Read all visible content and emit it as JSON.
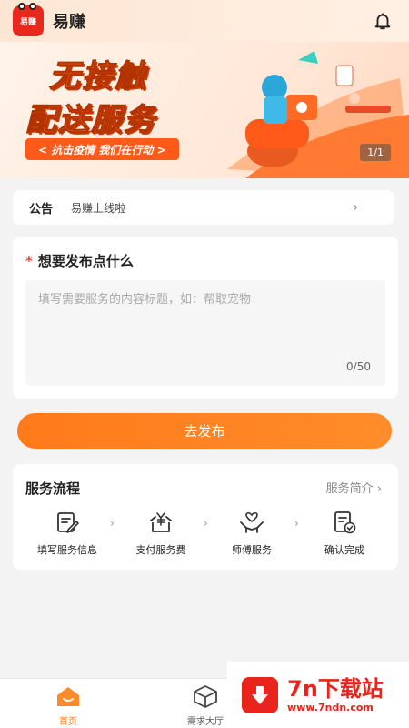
{
  "header": {
    "logo_text": "易赚",
    "app_name": "易赚"
  },
  "banner": {
    "title_line1": "无接触",
    "title_line2": "配送服务",
    "slogan": "< 抗击疫情 我们在行动 >",
    "pager": "1/1"
  },
  "notice": {
    "label": "公告",
    "text": "易赚上线啦",
    "arrow": "›"
  },
  "publish": {
    "required_mark": "*",
    "heading": "想要发布点什么",
    "placeholder": "填写需要服务的内容标题，如：帮取宠物",
    "value": "",
    "counter": "0/50"
  },
  "submit_button": "去发布",
  "flow": {
    "title": "服务流程",
    "intro_link": "服务简介 ›",
    "steps": [
      {
        "label": "填写服务信息",
        "icon": "edit-form-icon"
      },
      {
        "label": "支付服务费",
        "icon": "yuan-payment-icon"
      },
      {
        "label": "师傅服务",
        "icon": "handshake-icon"
      },
      {
        "label": "确认完成",
        "icon": "check-document-icon"
      }
    ],
    "separator": "›"
  },
  "tabs": [
    {
      "label": "首页",
      "icon": "home-icon",
      "active": true
    },
    {
      "label": "需求大厅",
      "icon": "box-icon",
      "active": false
    }
  ],
  "watermark": {
    "brand": "7n下载站",
    "url": "www.7ndn.com"
  },
  "colors": {
    "accent": "#ff7a1a",
    "brand_red": "#e8281c",
    "background": "#f3f3f3"
  }
}
